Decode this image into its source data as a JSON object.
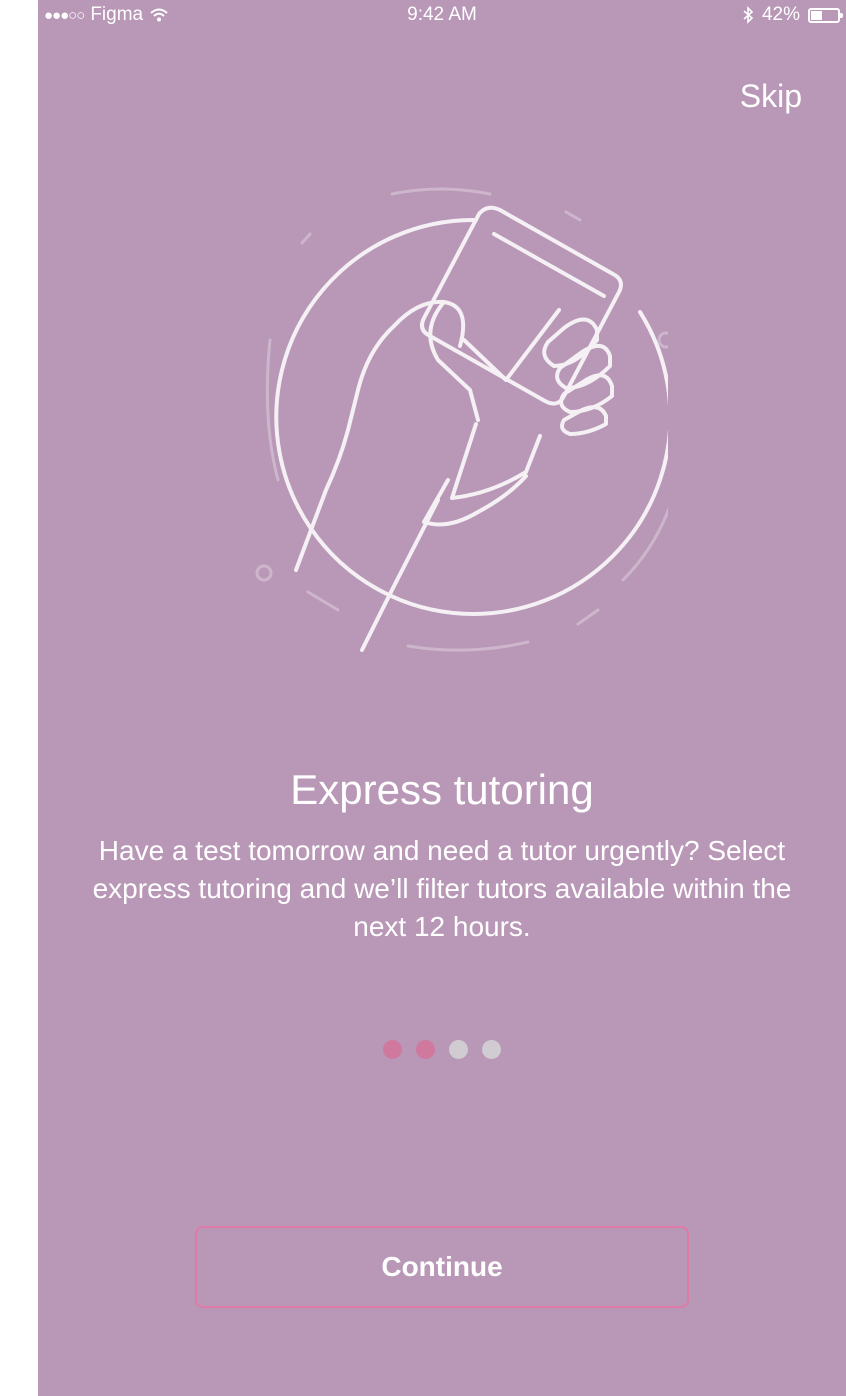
{
  "status_bar": {
    "carrier": "Figma",
    "signal_dots": "●●●○○",
    "time": "9:42 AM",
    "battery_percent": "42%",
    "battery_level": 0.42
  },
  "header": {
    "skip_label": "Skip"
  },
  "illustration": {
    "icon": "hand-holding-phone-with-check-icon"
  },
  "content": {
    "title": "Express tutoring",
    "description": "Have a test tomorrow and need a tutor urgently? Select express tutoring and we’ll filter tutors available within the next 12 hours."
  },
  "pager": {
    "total": 4,
    "active_count": 2,
    "active_color": "#d1789f",
    "inactive_color": "#d0ccd2"
  },
  "actions": {
    "continue_label": "Continue"
  },
  "colors": {
    "background": "#b997b7",
    "accent": "#e07aa6"
  }
}
